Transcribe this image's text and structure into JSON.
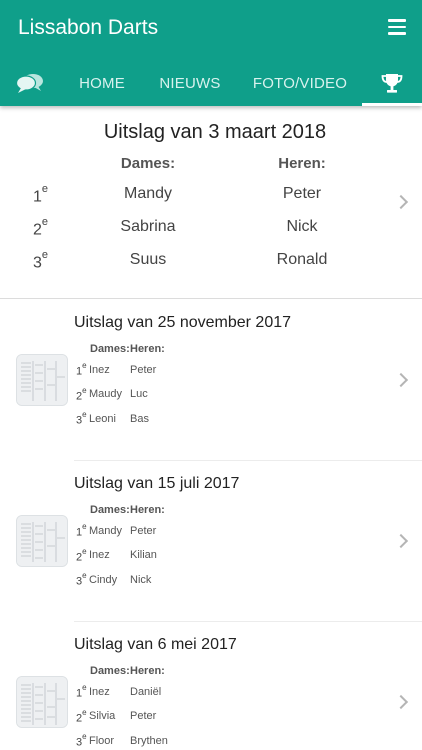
{
  "app": {
    "title": "Lissabon Darts"
  },
  "tabs": [
    {
      "label": "",
      "icon": "chat-bubbles-icon"
    },
    {
      "label": "HOME"
    },
    {
      "label": "NIEUWS"
    },
    {
      "label": "FOTO/VIDEO"
    },
    {
      "label": "",
      "icon": "trophy-icon",
      "active": true
    }
  ],
  "colors": {
    "primary": "#0f9f8a",
    "tab_inactive": "#d8f2ee",
    "indicator": "#ffffff"
  },
  "latest": {
    "title": "Uitslag van 3 maart 2018",
    "dames_header": "Dames:",
    "heren_header": "Heren:",
    "rows": [
      {
        "place": "1",
        "suffix": "e",
        "dames": "Mandy",
        "heren": "Peter"
      },
      {
        "place": "2",
        "suffix": "e",
        "dames": "Sabrina",
        "heren": "Nick"
      },
      {
        "place": "3",
        "suffix": "e",
        "dames": "Suus",
        "heren": "Ronald"
      }
    ]
  },
  "archive": [
    {
      "title": "Uitslag van 25 november 2017",
      "dames_header": "Dames:",
      "heren_header": "Heren:",
      "rows": [
        {
          "place": "1",
          "suffix": "e",
          "dames": "Inez",
          "heren": "Peter"
        },
        {
          "place": "2",
          "suffix": "e",
          "dames": "Maudy",
          "heren": "Luc"
        },
        {
          "place": "3",
          "suffix": "e",
          "dames": "Leoni",
          "heren": "Bas"
        }
      ]
    },
    {
      "title": "Uitslag van 15 juli 2017",
      "dames_header": "Dames:",
      "heren_header": "Heren:",
      "rows": [
        {
          "place": "1",
          "suffix": "e",
          "dames": "Mandy",
          "heren": "Peter"
        },
        {
          "place": "2",
          "suffix": "e",
          "dames": "Inez",
          "heren": "Kilian"
        },
        {
          "place": "3",
          "suffix": "e",
          "dames": "Cindy",
          "heren": "Nick"
        }
      ]
    },
    {
      "title": "Uitslag van 6 mei 2017",
      "dames_header": "Dames:",
      "heren_header": "Heren:",
      "rows": [
        {
          "place": "1",
          "suffix": "e",
          "dames": "Inez",
          "heren": "Daniël"
        },
        {
          "place": "2",
          "suffix": "e",
          "dames": "Silvia",
          "heren": "Peter"
        },
        {
          "place": "3",
          "suffix": "e",
          "dames": "Floor",
          "heren": "Brythen"
        }
      ]
    }
  ]
}
